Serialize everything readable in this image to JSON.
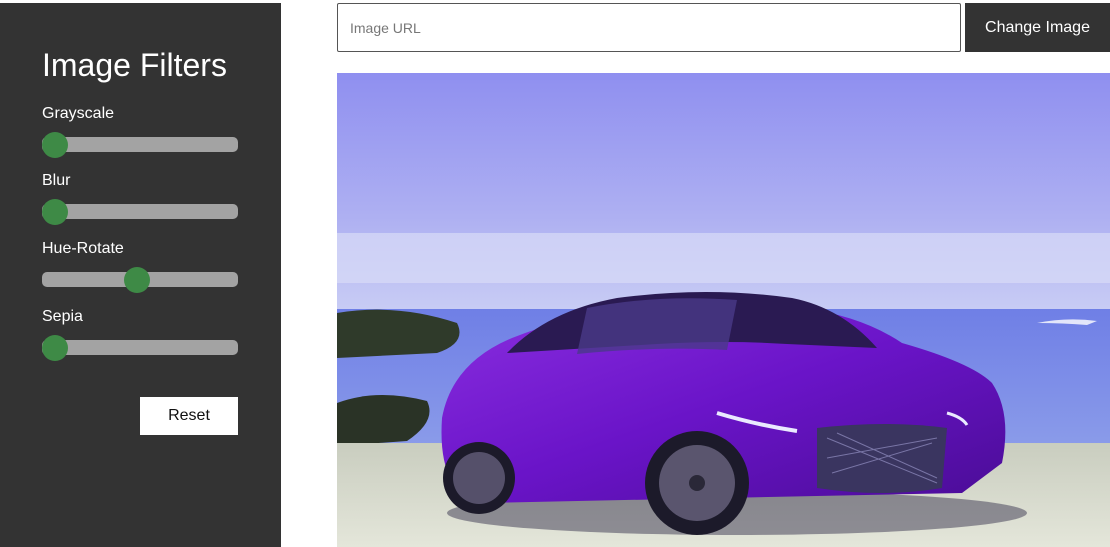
{
  "sidebar": {
    "title": "Image Filters",
    "filters": [
      {
        "label": "Grayscale",
        "value_fraction": 0.0
      },
      {
        "label": "Blur",
        "value_fraction": 0.0
      },
      {
        "label": "Hue-Rotate",
        "value_fraction": 0.48
      },
      {
        "label": "Sepia",
        "value_fraction": 0.0
      }
    ],
    "reset_label": "Reset"
  },
  "toolbar": {
    "url_placeholder": "Image URL",
    "url_value": "",
    "change_label": "Change Image"
  },
  "image": {
    "subject": "purple sedan parked on a beach by the sea"
  },
  "colors": {
    "sidebar_bg": "#333333",
    "slider_track": "#a3a3a3",
    "slider_thumb": "#3e8a46",
    "button_dark": "#333333"
  },
  "icons": []
}
